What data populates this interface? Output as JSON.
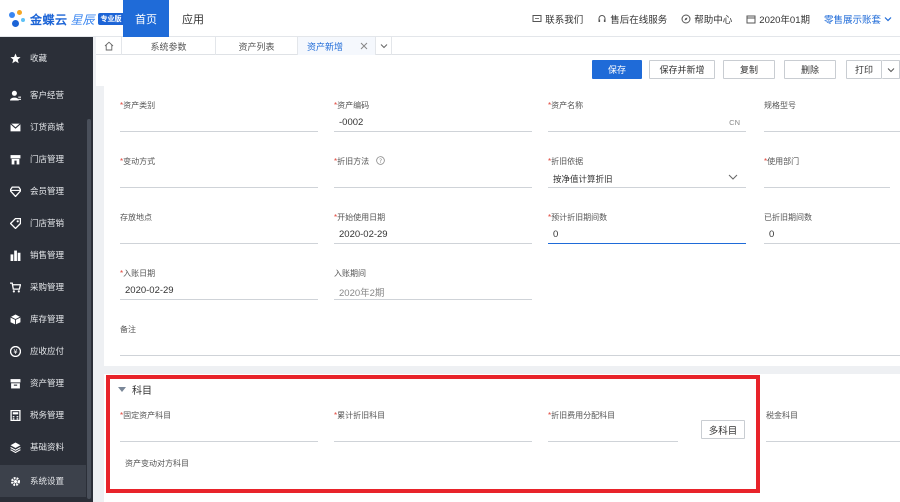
{
  "brand": {
    "name": "金蝶云",
    "sub": "星辰",
    "badge": "专业版"
  },
  "topnav": {
    "home": "首页",
    "app": "应用"
  },
  "top_links": [
    {
      "label": "联系我们",
      "icon": "chat-icon"
    },
    {
      "label": "售后在线服务",
      "icon": "headset-icon"
    },
    {
      "label": "帮助中心",
      "icon": "compass-icon"
    },
    {
      "label": "2020年01期",
      "icon": "calendar-icon"
    }
  ],
  "account": "零售展示账套",
  "sidebar": [
    {
      "label": "收藏",
      "icon": "star-icon"
    },
    {
      "label": "客户经营",
      "icon": "user-icon"
    },
    {
      "label": "订货商城",
      "icon": "mail-icon"
    },
    {
      "label": "门店管理",
      "icon": "store-icon"
    },
    {
      "label": "会员管理",
      "icon": "diamond-icon"
    },
    {
      "label": "门店营销",
      "icon": "tag-icon"
    },
    {
      "label": "销售管理",
      "icon": "bar-chart-icon"
    },
    {
      "label": "采购管理",
      "icon": "cart-icon"
    },
    {
      "label": "库存管理",
      "icon": "box-icon"
    },
    {
      "label": "应收应付",
      "icon": "coin-icon"
    },
    {
      "label": "资产管理",
      "icon": "drawer-icon"
    },
    {
      "label": "税务管理",
      "icon": "calculator-icon"
    },
    {
      "label": "基础资料",
      "icon": "layers-icon"
    },
    {
      "label": "系统设置",
      "icon": "gear-icon"
    }
  ],
  "tabs": [
    {
      "label": "系统参数"
    },
    {
      "label": "资产列表"
    },
    {
      "label": "资产新增"
    }
  ],
  "toolbar": {
    "save": "保存",
    "save_new": "保存并新增",
    "copy": "复制",
    "delete": "删除",
    "print": "打印"
  },
  "form": {
    "asset_type": "资产类别",
    "asset_code": "资产编码",
    "asset_code_val": "-0002",
    "asset_name": "资产名称",
    "asset_name_suffix": "CN",
    "spec": "规格型号",
    "change_mode": "变动方式",
    "dep_method": "折旧方法",
    "dep_basis": "折旧依据",
    "dep_basis_val": "按净值计算折旧",
    "dept": "使用部门",
    "location": "存放地点",
    "start_date": "开始使用日期",
    "start_date_val": "2020-02-29",
    "est_periods": "预计折旧期间数",
    "est_periods_val": "0",
    "used_periods": "已折旧期间数",
    "used_periods_val": "0",
    "entry_date": "入账日期",
    "entry_date_val": "2020-02-29",
    "entry_period": "入账期间",
    "entry_period_val": "2020年2期",
    "remark": "备注"
  },
  "accounts": {
    "title": "科目",
    "fixed_asset": "固定资产科目",
    "acc_dep": "累计折旧科目",
    "dep_expense": "折旧费用分配科目",
    "multi": "多科目",
    "tax": "税金科目",
    "change_offset": "资产变动对方科目"
  }
}
